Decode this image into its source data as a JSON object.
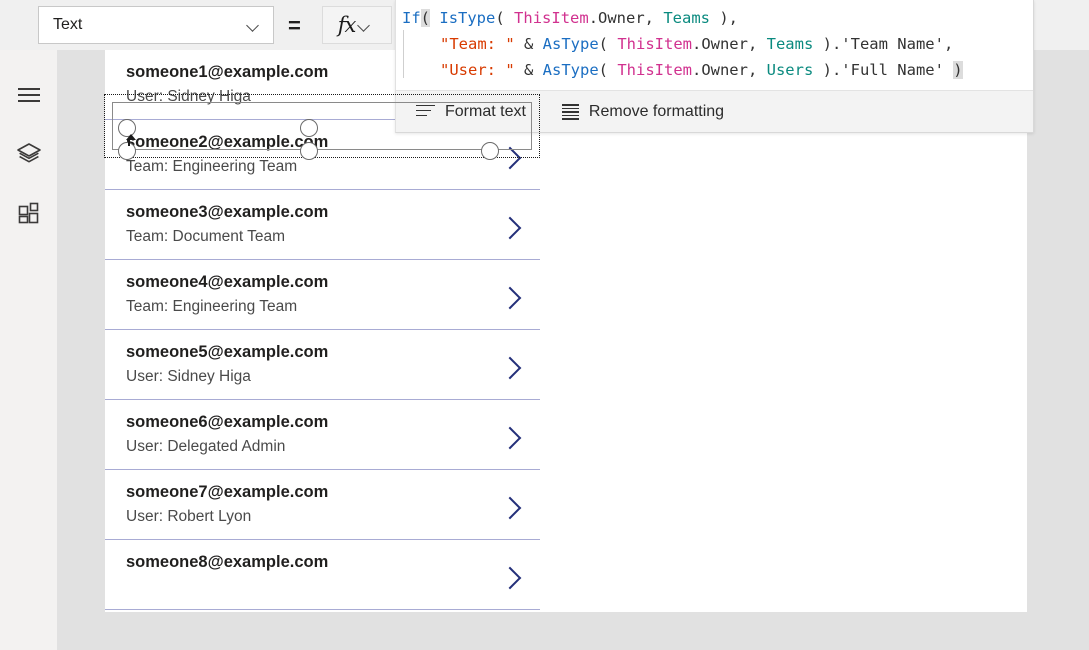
{
  "toolbar": {
    "property_label": "Text",
    "equals_sign": "=",
    "fx_label": "fx",
    "chevron_icon": "chevron-down-icon"
  },
  "formula_bar": {
    "lines": [
      {
        "indent": false,
        "tokens": [
          {
            "text": "If",
            "kind": "fn"
          },
          {
            "text": "(",
            "kind": "paren-hl"
          },
          {
            "text": " ",
            "kind": "punc"
          },
          {
            "text": "IsType",
            "kind": "fn"
          },
          {
            "text": "( ",
            "kind": "punc"
          },
          {
            "text": "ThisItem",
            "kind": "item"
          },
          {
            "text": ".Owner, ",
            "kind": "prop"
          },
          {
            "text": "Teams",
            "kind": "type"
          },
          {
            "text": " ),",
            "kind": "punc"
          }
        ]
      },
      {
        "indent": true,
        "tokens": [
          {
            "text": "\"Team: \"",
            "kind": "str"
          },
          {
            "text": " & ",
            "kind": "punc"
          },
          {
            "text": "AsType",
            "kind": "fn"
          },
          {
            "text": "( ",
            "kind": "punc"
          },
          {
            "text": "ThisItem",
            "kind": "item"
          },
          {
            "text": ".Owner, ",
            "kind": "prop"
          },
          {
            "text": "Teams",
            "kind": "type"
          },
          {
            "text": " ).'Team Name',",
            "kind": "punc"
          }
        ]
      },
      {
        "indent": true,
        "tokens": [
          {
            "text": "\"User: \"",
            "kind": "str"
          },
          {
            "text": " & ",
            "kind": "punc"
          },
          {
            "text": "AsType",
            "kind": "fn"
          },
          {
            "text": "( ",
            "kind": "punc"
          },
          {
            "text": "ThisItem",
            "kind": "item"
          },
          {
            "text": ".Owner, ",
            "kind": "prop"
          },
          {
            "text": "Users",
            "kind": "type"
          },
          {
            "text": " ).'Full Name' ",
            "kind": "punc"
          },
          {
            "text": ")",
            "kind": "paren-hl"
          }
        ]
      }
    ],
    "format_actions": [
      {
        "label": "Format text",
        "icon": "format-text-icon"
      },
      {
        "label": "Remove formatting",
        "icon": "remove-formatting-icon"
      }
    ]
  },
  "rail": {
    "items": [
      {
        "name": "menu-toggle",
        "icon": "hamburger-icon"
      },
      {
        "name": "tree-view",
        "icon": "layers-icon"
      },
      {
        "name": "insert",
        "icon": "grid-insert-icon"
      }
    ]
  },
  "gallery": {
    "items": [
      {
        "title": "someone1@example.com",
        "subtitle": "User: Sidney Higa"
      },
      {
        "title": "someone2@example.com",
        "subtitle": "Team: Engineering Team"
      },
      {
        "title": "someone3@example.com",
        "subtitle": "Team: Document Team"
      },
      {
        "title": "someone4@example.com",
        "subtitle": "Team: Engineering Team"
      },
      {
        "title": "someone5@example.com",
        "subtitle": "User: Sidney Higa"
      },
      {
        "title": "someone6@example.com",
        "subtitle": "User: Delegated Admin"
      },
      {
        "title": "someone7@example.com",
        "subtitle": "User: Robert Lyon"
      },
      {
        "title": "someone8@example.com",
        "subtitle": ""
      }
    ],
    "chevron_icon": "chevron-right-icon"
  },
  "colors": {
    "function": "#1b6ec2",
    "this_item": "#d1318f",
    "data_type": "#0a8a7f",
    "string": "#d83b01",
    "separator": "#a8abd4",
    "chevron": "#24307a",
    "workspace_bg": "#e1e1e1",
    "topbar_bg": "#f0f0f0",
    "rail_bg": "#f3f2f1"
  }
}
